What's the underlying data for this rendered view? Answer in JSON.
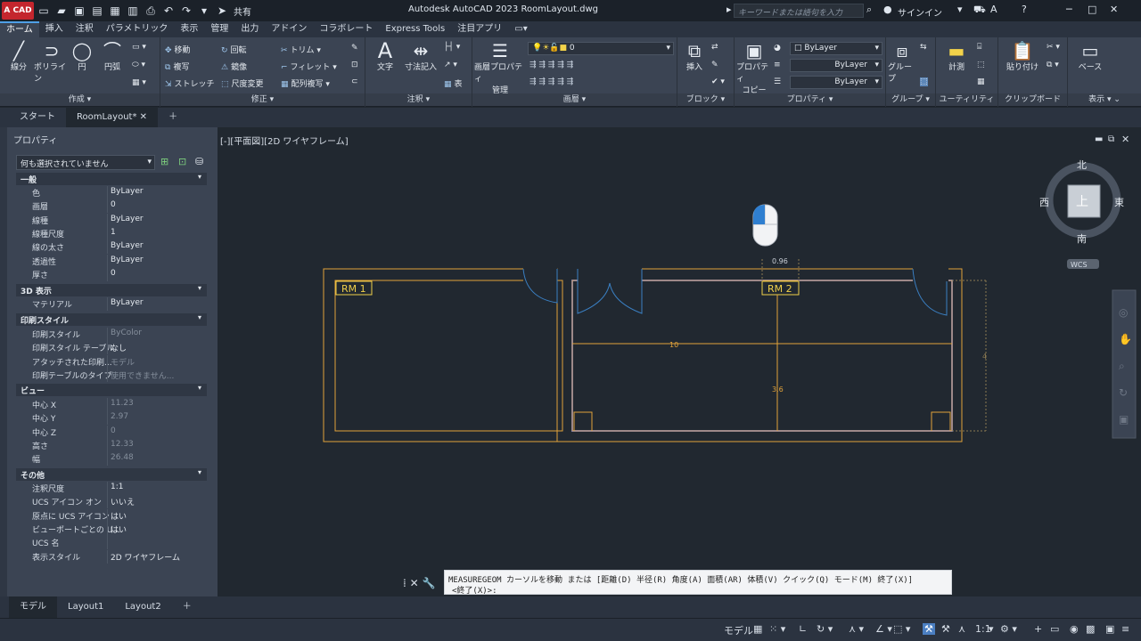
{
  "title_bar": {
    "logo": "A CAD",
    "share_label": "共有",
    "title": "Autodesk AutoCAD 2023    RoomLayout.dwg",
    "search_placeholder": "キーワードまたは語句を入力",
    "signin_label": "サインイン"
  },
  "ribbon_tabs": [
    "ホーム",
    "挿入",
    "注釈",
    "パラメトリック",
    "表示",
    "管理",
    "出力",
    "アドイン",
    "コラボレート",
    "Express Tools",
    "注目アプリ"
  ],
  "ribbon": {
    "draw": {
      "title": "作成",
      "line": "線分",
      "polyline": "ポリライン",
      "circle": "円",
      "arc": "円弧"
    },
    "modify": {
      "title": "修正",
      "move": "移動",
      "rotate": "回転",
      "trim": "トリム",
      "copy": "複写",
      "mirror": "鏡像",
      "fillet": "フィレット",
      "stretch": "ストレッチ",
      "scale": "尺度変更",
      "array": "配列複写"
    },
    "annotation": {
      "title": "注釈",
      "text": "文字",
      "dimension": "寸法記入",
      "table": "表"
    },
    "layers": {
      "title": "画層",
      "props": "画層プロパティ\n管理",
      "props_line1": "画層プロパティ",
      "props_line2": "管理",
      "current": "0"
    },
    "block": {
      "title": "ブロック",
      "insert": "挿入"
    },
    "properties": {
      "title": "プロパティ",
      "match_line1": "プロパティ",
      "match_line2": "コピー",
      "color": "ByLayer",
      "linetype": "ByLayer",
      "lineweight": "ByLayer"
    },
    "groups": {
      "title": "グループ",
      "group": "グループ"
    },
    "utilities": {
      "title": "ユーティリティ",
      "measure": "計測"
    },
    "clipboard": {
      "title": "クリップボード",
      "paste": "貼り付け"
    },
    "view": {
      "title": "表示",
      "base": "ベース"
    }
  },
  "doc_tabs": {
    "start": "スタート",
    "current": "RoomLayout*"
  },
  "properties_panel": {
    "title": "プロパティ",
    "selection": "何も選択されていません",
    "sections": {
      "general": "一般",
      "view3d": "3D 表示",
      "plotstyle": "印刷スタイル",
      "view": "ビュー",
      "misc": "その他"
    },
    "general_rows": [
      {
        "k": "色",
        "v": "ByLayer"
      },
      {
        "k": "画層",
        "v": "0"
      },
      {
        "k": "線種",
        "v": "ByLayer"
      },
      {
        "k": "線種尺度",
        "v": "1"
      },
      {
        "k": "線の太さ",
        "v": "ByLayer"
      },
      {
        "k": "透過性",
        "v": "ByLayer"
      },
      {
        "k": "厚さ",
        "v": "0"
      }
    ],
    "view3d_rows": [
      {
        "k": "マテリアル",
        "v": "ByLayer"
      }
    ],
    "plot_rows": [
      {
        "k": "印刷スタイル",
        "v": "ByColor"
      },
      {
        "k": "印刷スタイル テーブル",
        "v": "なし"
      },
      {
        "k": "アタッチされた印刷...",
        "v": "モデル"
      },
      {
        "k": "印刷テーブルのタイプ",
        "v": "使用できません..."
      }
    ],
    "view_rows": [
      {
        "k": "中心 X",
        "v": "11.23"
      },
      {
        "k": "中心 Y",
        "v": "2.97"
      },
      {
        "k": "中心 Z",
        "v": "0"
      },
      {
        "k": "高さ",
        "v": "12.33"
      },
      {
        "k": "幅",
        "v": "26.48"
      }
    ],
    "misc_rows": [
      {
        "k": "注釈尺度",
        "v": "1:1"
      },
      {
        "k": "UCS アイコン オン",
        "v": "いいえ"
      },
      {
        "k": "原点に UCS アイコン",
        "v": "はい"
      },
      {
        "k": "ビューポートごとの U...",
        "v": "はい"
      },
      {
        "k": "UCS 名",
        "v": ""
      },
      {
        "k": "表示スタイル",
        "v": "2D ワイヤフレーム"
      }
    ]
  },
  "viewport": {
    "label": "[-][平面図][2D ワイヤフレーム]",
    "room1": "RM 1",
    "room2": "RM 2",
    "dim_top": "0.96",
    "dim_width": "10",
    "dim_height": "3.6",
    "dim_right": "4"
  },
  "viewcube": {
    "north": "北",
    "south": "南",
    "east": "東",
    "west": "西",
    "top": "上",
    "wcs": "WCS"
  },
  "command_line": {
    "line1": "MEASUREGEOM カーソルを移動 または [距離(D) 半径(R) 角度(A) 面積(AR) 体積(V) クイック(Q) モード(M) 終了(X)]",
    "line2": "<終了(X)>:"
  },
  "layout_tabs": [
    "モデル",
    "Layout1",
    "Layout2"
  ],
  "status": {
    "model": "モデル",
    "scale": "1:1"
  }
}
